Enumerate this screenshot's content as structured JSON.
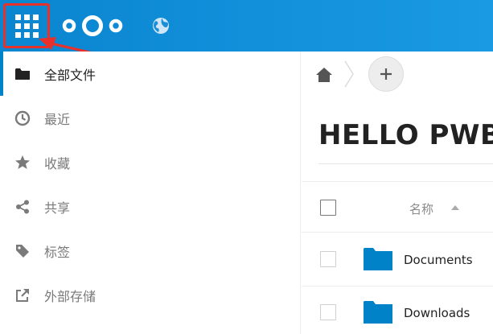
{
  "header": {
    "apps_icon": "apps-grid-icon",
    "logo_icon": "nextcloud-logo-icon",
    "globe_icon": "globe-icon",
    "accent": "#0082c9",
    "highlight": "#e8312b"
  },
  "sidebar": {
    "items": [
      {
        "label": "全部文件",
        "icon": "folder-icon",
        "active": true
      },
      {
        "label": "最近",
        "icon": "clock-icon",
        "active": false
      },
      {
        "label": "收藏",
        "icon": "star-icon",
        "active": false
      },
      {
        "label": "共享",
        "icon": "share-icon",
        "active": false
      },
      {
        "label": "标签",
        "icon": "tag-icon",
        "active": false
      },
      {
        "label": "外部存储",
        "icon": "external-link-icon",
        "active": false
      }
    ]
  },
  "main": {
    "title": "HELLO PWB",
    "breadcrumb": {
      "home_icon": "home-icon",
      "add_icon": "plus-icon"
    },
    "table": {
      "name_header": "名称",
      "rows": [
        {
          "name": "Documents",
          "icon": "folder-icon"
        },
        {
          "name": "Downloads",
          "icon": "folder-icon"
        }
      ]
    }
  }
}
